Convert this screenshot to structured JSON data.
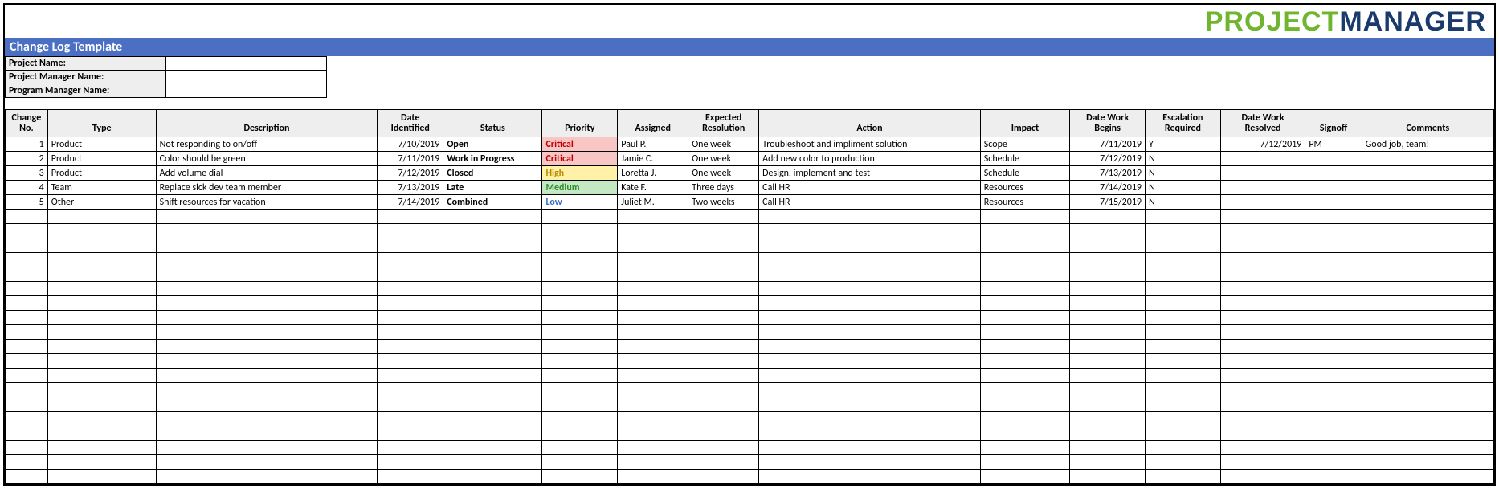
{
  "logo": {
    "part1": "PROJECT",
    "part2": "MANAGER"
  },
  "title": "Change Log Template",
  "meta": {
    "project_name_label": "Project Name:",
    "project_name_value": "",
    "pm_name_label": "Project Manager Name:",
    "pm_name_value": "",
    "prog_name_label": "Program Manager Name:",
    "prog_name_value": ""
  },
  "columns": [
    "Change No.",
    "Type",
    "Description",
    "Date Identified",
    "Status",
    "Priority",
    "Assigned",
    "Expected Resolution",
    "Action",
    "Impact",
    "Date Work Begins",
    "Escalation Required",
    "Date Work Resolved",
    "Signoff",
    "Comments"
  ],
  "rows": [
    {
      "no": "1",
      "type": "Product",
      "desc": "Not responding to on/off",
      "dateid": "7/10/2019",
      "status": "Open",
      "priority": "Critical",
      "assigned": "Paul P.",
      "expres": "One week",
      "action": "Troubleshoot and impliment solution",
      "impact": "Scope",
      "dwb": "7/11/2019",
      "esc": "Y",
      "dwr": "7/12/2019",
      "sign": "PM",
      "comments": "Good job, team!"
    },
    {
      "no": "2",
      "type": "Product",
      "desc": "Color should be green",
      "dateid": "7/11/2019",
      "status": "Work in Progress",
      "priority": "Critical",
      "assigned": "Jamie C.",
      "expres": "One week",
      "action": "Add new color to production",
      "impact": "Schedule",
      "dwb": "7/12/2019",
      "esc": "N",
      "dwr": "",
      "sign": "",
      "comments": ""
    },
    {
      "no": "3",
      "type": "Product",
      "desc": "Add volume dial",
      "dateid": "7/12/2019",
      "status": "Closed",
      "priority": "High",
      "assigned": "Loretta J.",
      "expres": "One week",
      "action": "Design, implement and test",
      "impact": "Schedule",
      "dwb": "7/13/2019",
      "esc": "N",
      "dwr": "",
      "sign": "",
      "comments": ""
    },
    {
      "no": "4",
      "type": "Team",
      "desc": "Replace sick dev team member",
      "dateid": "7/13/2019",
      "status": "Late",
      "priority": "Medium",
      "assigned": "Kate F.",
      "expres": "Three days",
      "action": "Call HR",
      "impact": "Resources",
      "dwb": "7/14/2019",
      "esc": "N",
      "dwr": "",
      "sign": "",
      "comments": ""
    },
    {
      "no": "5",
      "type": "Other",
      "desc": "Shift resources for vacation",
      "dateid": "7/14/2019",
      "status": "Combined",
      "priority": "Low",
      "assigned": "Juliet M.",
      "expres": "Two weeks",
      "action": "Call HR",
      "impact": "Resources",
      "dwb": "7/15/2019",
      "esc": "N",
      "dwr": "",
      "sign": "",
      "comments": ""
    }
  ],
  "empty_row_count": 19,
  "priority_classes": {
    "Critical": "prio-critical",
    "High": "prio-high",
    "Medium": "prio-medium",
    "Low": "prio-low"
  }
}
